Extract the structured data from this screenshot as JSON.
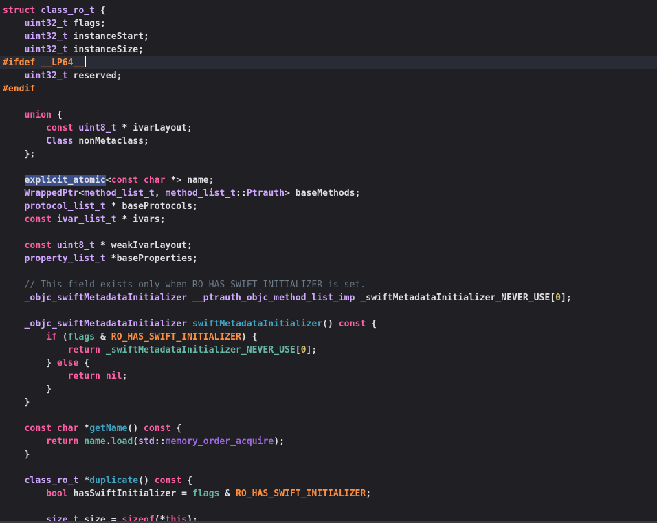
{
  "editor": {
    "colors": {
      "background": "#1f1f24",
      "current_line": "#2a2c35",
      "keyword": "#fc5fa3",
      "type": "#d0a8ff",
      "preprocessor": "#fd8f3f",
      "comment": "#6c7986",
      "number": "#d0bf69",
      "plain": "#dedee3",
      "function": "#41a1c0",
      "selection": "#3b4f8c"
    },
    "lines": [
      [
        [
          "kw",
          "struct"
        ],
        [
          "pt",
          " "
        ],
        [
          "ty",
          "class_ro_t"
        ],
        [
          "pt",
          " {"
        ]
      ],
      [
        [
          "pt",
          "    "
        ],
        [
          "ty",
          "uint32_t"
        ],
        [
          "pt",
          " flags;"
        ]
      ],
      [
        [
          "pt",
          "    "
        ],
        [
          "ty",
          "uint32_t"
        ],
        [
          "pt",
          " instanceStart;"
        ]
      ],
      [
        [
          "pt",
          "    "
        ],
        [
          "ty",
          "uint32_t"
        ],
        [
          "pt",
          " instanceSize;"
        ]
      ],
      [
        [
          "pp",
          "#ifdef __LP64__"
        ],
        [
          "caret",
          ""
        ]
      ],
      [
        [
          "pt",
          "    "
        ],
        [
          "ty",
          "uint32_t"
        ],
        [
          "pt",
          " reserved;"
        ]
      ],
      [
        [
          "pp",
          "#endif"
        ]
      ],
      [],
      [
        [
          "pt",
          "    "
        ],
        [
          "kw",
          "union"
        ],
        [
          "pt",
          " {"
        ]
      ],
      [
        [
          "pt",
          "        "
        ],
        [
          "kw",
          "const"
        ],
        [
          "pt",
          " "
        ],
        [
          "ty",
          "uint8_t"
        ],
        [
          "pt",
          " * ivarLayout;"
        ]
      ],
      [
        [
          "pt",
          "        "
        ],
        [
          "ty",
          "Class"
        ],
        [
          "pt",
          " nonMetaclass;"
        ]
      ],
      [
        [
          "pt",
          "    };"
        ]
      ],
      [],
      [
        [
          "pt",
          "    "
        ],
        [
          "sel",
          "explicit_atomic"
        ],
        [
          "pt",
          "<"
        ],
        [
          "kw",
          "const"
        ],
        [
          "pt",
          " "
        ],
        [
          "kw",
          "char"
        ],
        [
          "pt",
          " *> name;"
        ]
      ],
      [
        [
          "pt",
          "    "
        ],
        [
          "ty",
          "WrappedPtr"
        ],
        [
          "pt",
          "<"
        ],
        [
          "ty",
          "method_list_t"
        ],
        [
          "pt",
          ", "
        ],
        [
          "ty",
          "method_list_t"
        ],
        [
          "pt",
          "::"
        ],
        [
          "ty",
          "Ptrauth"
        ],
        [
          "pt",
          "> baseMethods;"
        ]
      ],
      [
        [
          "pt",
          "    "
        ],
        [
          "ty",
          "protocol_list_t"
        ],
        [
          "pt",
          " * baseProtocols;"
        ]
      ],
      [
        [
          "pt",
          "    "
        ],
        [
          "kw",
          "const"
        ],
        [
          "pt",
          " "
        ],
        [
          "ty",
          "ivar_list_t"
        ],
        [
          "pt",
          " * ivars;"
        ]
      ],
      [],
      [
        [
          "pt",
          "    "
        ],
        [
          "kw",
          "const"
        ],
        [
          "pt",
          " "
        ],
        [
          "ty",
          "uint8_t"
        ],
        [
          "pt",
          " * weakIvarLayout;"
        ]
      ],
      [
        [
          "pt",
          "    "
        ],
        [
          "ty",
          "property_list_t"
        ],
        [
          "pt",
          " *baseProperties;"
        ]
      ],
      [],
      [
        [
          "pt",
          "    "
        ],
        [
          "cm",
          "// This field exists only when RO_HAS_SWIFT_INITIALIZER is set."
        ]
      ],
      [
        [
          "pt",
          "    "
        ],
        [
          "ty",
          "_objc_swiftMetadataInitializer"
        ],
        [
          "pt",
          " "
        ],
        [
          "ty",
          "__ptrauth_objc_method_list_imp"
        ],
        [
          "pt",
          " _swiftMetadataInitializer_NEVER_USE["
        ],
        [
          "nm",
          "0"
        ],
        [
          "pt",
          "];"
        ]
      ],
      [],
      [
        [
          "pt",
          "    "
        ],
        [
          "ty",
          "_objc_swiftMetadataInitializer"
        ],
        [
          "pt",
          " "
        ],
        [
          "fn",
          "swiftMetadataInitializer"
        ],
        [
          "pt",
          "() "
        ],
        [
          "kw",
          "const"
        ],
        [
          "pt",
          " {"
        ]
      ],
      [
        [
          "pt",
          "        "
        ],
        [
          "kw",
          "if"
        ],
        [
          "pt",
          " ("
        ],
        [
          "pj",
          "flags"
        ],
        [
          "pt",
          " & "
        ],
        [
          "pp",
          "RO_HAS_SWIFT_INITIALIZER"
        ],
        [
          "pt",
          ") {"
        ]
      ],
      [
        [
          "pt",
          "            "
        ],
        [
          "kw",
          "return"
        ],
        [
          "pt",
          " "
        ],
        [
          "pj",
          "_swiftMetadataInitializer_NEVER_USE"
        ],
        [
          "pt",
          "["
        ],
        [
          "nm",
          "0"
        ],
        [
          "pt",
          "];"
        ]
      ],
      [
        [
          "pt",
          "        } "
        ],
        [
          "kw",
          "else"
        ],
        [
          "pt",
          " {"
        ]
      ],
      [
        [
          "pt",
          "            "
        ],
        [
          "kw",
          "return"
        ],
        [
          "pt",
          " "
        ],
        [
          "kw",
          "nil"
        ],
        [
          "pt",
          ";"
        ]
      ],
      [
        [
          "pt",
          "        }"
        ]
      ],
      [
        [
          "pt",
          "    }"
        ]
      ],
      [],
      [
        [
          "pt",
          "    "
        ],
        [
          "kw",
          "const"
        ],
        [
          "pt",
          " "
        ],
        [
          "kw",
          "char"
        ],
        [
          "pt",
          " *"
        ],
        [
          "fn",
          "getName"
        ],
        [
          "pt",
          "() "
        ],
        [
          "kw",
          "const"
        ],
        [
          "pt",
          " {"
        ]
      ],
      [
        [
          "pt",
          "        "
        ],
        [
          "kw",
          "return"
        ],
        [
          "pt",
          " "
        ],
        [
          "pj",
          "name"
        ],
        [
          "pt",
          "."
        ],
        [
          "pj",
          "load"
        ],
        [
          "pt",
          "("
        ],
        [
          "ty",
          "std"
        ],
        [
          "pt",
          "::"
        ],
        [
          "pa",
          "memory_order_acquire"
        ],
        [
          "pt",
          ");"
        ]
      ],
      [
        [
          "pt",
          "    }"
        ]
      ],
      [],
      [
        [
          "pt",
          "    "
        ],
        [
          "ty",
          "class_ro_t"
        ],
        [
          "pt",
          " *"
        ],
        [
          "fn",
          "duplicate"
        ],
        [
          "pt",
          "() "
        ],
        [
          "kw",
          "const"
        ],
        [
          "pt",
          " {"
        ]
      ],
      [
        [
          "pt",
          "        "
        ],
        [
          "kw",
          "bool"
        ],
        [
          "pt",
          " hasSwiftInitializer = "
        ],
        [
          "pj",
          "flags"
        ],
        [
          "pt",
          " & "
        ],
        [
          "pp",
          "RO_HAS_SWIFT_INITIALIZER"
        ],
        [
          "pt",
          ";"
        ]
      ],
      [],
      [
        [
          "pt",
          "        "
        ],
        [
          "ty",
          "size_t"
        ],
        [
          "pt",
          " size = "
        ],
        [
          "kw",
          "sizeof"
        ],
        [
          "pt",
          "(*"
        ],
        [
          "kw",
          "this"
        ],
        [
          "pt",
          ");"
        ]
      ]
    ]
  }
}
